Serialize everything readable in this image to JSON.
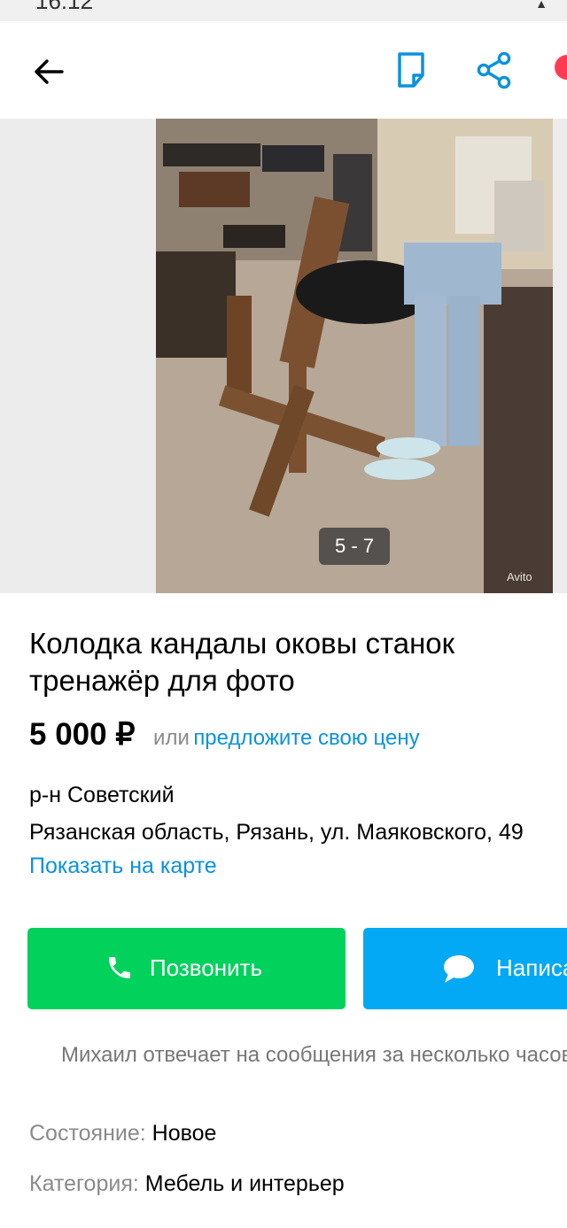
{
  "status_bar": {
    "time": "16:12"
  },
  "header": {
    "icons": [
      "back-arrow-icon",
      "note-icon",
      "share-icon",
      "favorite-icon"
    ],
    "accent": "#0a92dd"
  },
  "gallery": {
    "counter": "5 - 7",
    "watermark": "Avito"
  },
  "listing": {
    "title": "Колодка кандалы оковы станок тренажёр для фото",
    "price": "5 000 ₽",
    "price_or": "или",
    "price_offer": "предложите свою цену",
    "district": "р-н Советский",
    "address": "Рязанская область, Рязань, ул. Маяковского, 49",
    "map_link": "Показать на карте"
  },
  "actions": {
    "call_label": "Позвонить",
    "write_label": "Написать",
    "call_color": "#02d15c",
    "write_color": "#03a9f4"
  },
  "seller_note": "Михаил отвечает на сообщения за несколько часов",
  "params": [
    {
      "label": "Состояние:",
      "value": "Новое"
    },
    {
      "label": "Категория:",
      "value": "Мебель и интерьер"
    }
  ]
}
